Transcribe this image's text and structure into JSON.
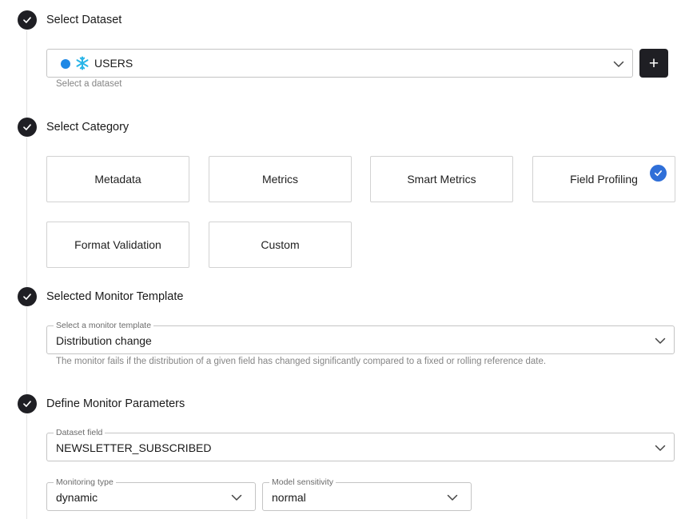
{
  "steps": [
    {
      "title": "Select Dataset",
      "icon": "check-icon"
    },
    {
      "title": "Select Category",
      "icon": "check-icon"
    },
    {
      "title": "Selected Monitor Template",
      "icon": "check-icon"
    },
    {
      "title": "Define Monitor Parameters",
      "icon": "check-icon"
    }
  ],
  "dataset": {
    "value": "USERS",
    "helper": "Select a dataset",
    "status_color": "#1e88e5",
    "source_icon": "snowflake-icon",
    "source_icon_color": "#29b5e8",
    "add_button_symbol": "+"
  },
  "categories": {
    "items": [
      {
        "label": "Metadata",
        "selected": false
      },
      {
        "label": "Metrics",
        "selected": false
      },
      {
        "label": "Smart Metrics",
        "selected": false
      },
      {
        "label": "Field Profiling",
        "selected": true
      },
      {
        "label": "Format Validation",
        "selected": false
      },
      {
        "label": "Custom",
        "selected": false
      }
    ],
    "selected_color": "#2f6fd8"
  },
  "template": {
    "label": "Select a monitor template",
    "value": "Distribution change",
    "helper": "The monitor fails if the distribution of a given field has changed significantly compared to a fixed or rolling reference date."
  },
  "parameters": {
    "field": {
      "label": "Dataset field",
      "value": "NEWSLETTER_SUBSCRIBED"
    },
    "monitoring_type": {
      "label": "Monitoring type",
      "value": "dynamic"
    },
    "model_sensitivity": {
      "label": "Model sensitivity",
      "value": "normal"
    }
  },
  "colors": {
    "dark": "#1f1f24",
    "border": "#c4c4c4",
    "helper_text": "#858585"
  }
}
